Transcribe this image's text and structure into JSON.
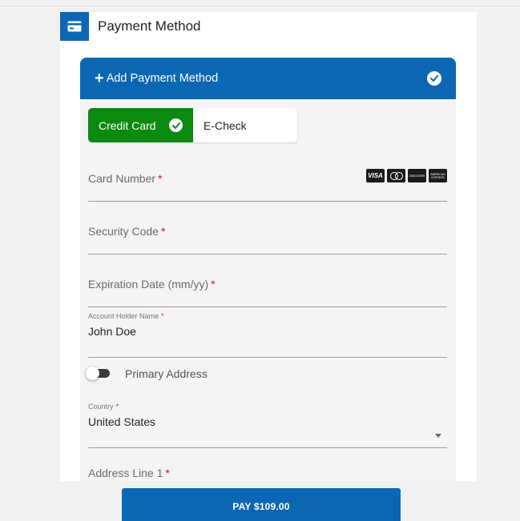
{
  "section": {
    "title": "Payment Method",
    "icon": "credit-card-icon"
  },
  "card": {
    "header_plus": "+",
    "header_title": "Add Payment Method",
    "header_icon": "check-circle-icon"
  },
  "payment_types": {
    "credit_card_label": "Credit Card",
    "echeck_label": "E-Check",
    "selected": "Credit Card",
    "selected_color": "#0a8a0f"
  },
  "fields": {
    "card_number": {
      "label": "Card Number",
      "required_mark": "*",
      "value": ""
    },
    "card_brands": [
      {
        "name": "VISA",
        "icon": "visa-logo-icon"
      },
      {
        "name": "Mastercard",
        "icon": "mastercard-logo-icon"
      },
      {
        "name": "DISCOVER",
        "icon": "discover-logo-icon"
      },
      {
        "name": "AMERICAN EXPRESS",
        "icon": "amex-logo-icon"
      }
    ],
    "security_code": {
      "label": "Security Code",
      "required_mark": "*",
      "value": ""
    },
    "expiration_date": {
      "label": "Expiration Date (mm/yy)",
      "required_mark": "*",
      "value": ""
    },
    "account_holder": {
      "label": "Account Holder Name",
      "required_mark": "*",
      "value": "John Doe"
    },
    "primary_address": {
      "label": "Primary Address",
      "checked": false
    },
    "country": {
      "label": "Country",
      "required_mark": "*",
      "value": "United States"
    },
    "address_line_1": {
      "label": "Address Line 1",
      "required_mark": "*",
      "value": ""
    }
  },
  "pay_button": {
    "label": "PAY $109.00"
  },
  "colors": {
    "primary": "#0b67b3",
    "success": "#0a8a0f",
    "required": "#d0121b"
  }
}
